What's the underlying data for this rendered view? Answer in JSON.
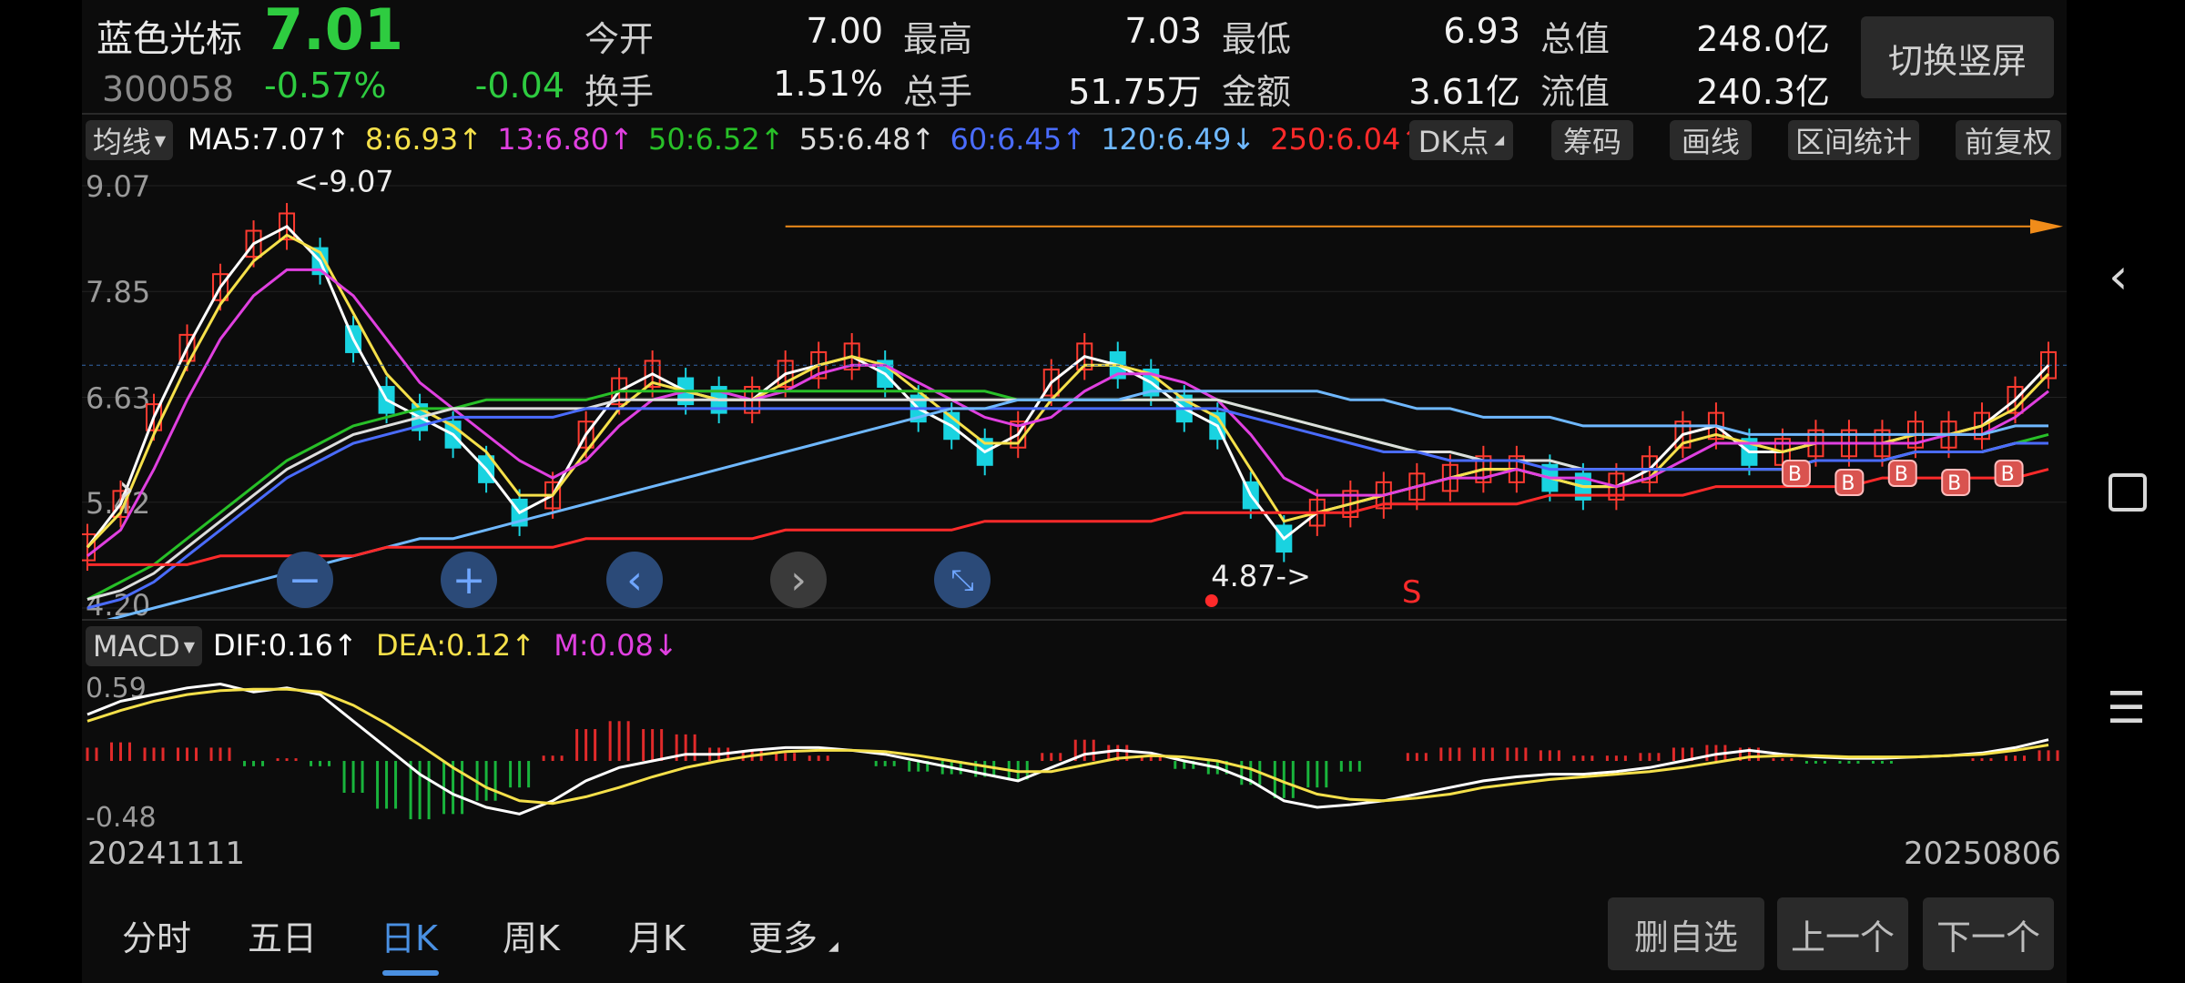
{
  "stock": {
    "name": "蓝色光标",
    "price": "7.01",
    "code": "300058",
    "change_pct": "-0.57%",
    "change": "-0.04"
  },
  "quote": {
    "open_label": "今开",
    "open": "7.00",
    "high_label": "最高",
    "high": "7.03",
    "low_label": "最低",
    "low": "6.93",
    "mktcap_label": "总值",
    "mktcap": "248.0亿",
    "turnover_label": "换手",
    "turnover": "1.51%",
    "volume_label": "总手",
    "volume": "51.75万",
    "amount_label": "金额",
    "amount": "3.61亿",
    "float_label": "流值",
    "float": "240.3亿"
  },
  "switch_button": "切换竖屏",
  "ma_bar": {
    "selector": "均线",
    "items": [
      {
        "text": "MA5:7.07↑",
        "color": "#ffffff"
      },
      {
        "text": "8:6.93↑",
        "color": "#f5e04a"
      },
      {
        "text": "13:6.80↑",
        "color": "#e040e0"
      },
      {
        "text": "50:6.52↑",
        "color": "#28c028"
      },
      {
        "text": "55:6.48↑",
        "color": "#dddddd"
      },
      {
        "text": "60:6.45↑",
        "color": "#4a6cff"
      },
      {
        "text": "120:6.49↓",
        "color": "#6fb8ff"
      },
      {
        "text": "250:6.04↑",
        "color": "#ff2a2a"
      }
    ],
    "buttons": [
      "DK点",
      "筹码",
      "画线",
      "区间统计",
      "前复权"
    ]
  },
  "chart_data": [
    {
      "type": "line",
      "title": "日K",
      "x_start": "20241111",
      "x_end": "20250806",
      "y_ticks": [
        "9.07",
        "7.85",
        "6.63",
        "5.42",
        "4.20"
      ],
      "ylim": [
        4.2,
        9.07
      ],
      "annotations": [
        "<-9.07",
        "4.87->",
        "S",
        "B"
      ],
      "series": [
        {
          "name": "MA5",
          "color": "#ffffff",
          "values": [
            4.9,
            5.4,
            6.4,
            7.2,
            7.9,
            8.4,
            8.6,
            8.2,
            7.3,
            6.6,
            6.4,
            6.2,
            5.8,
            5.3,
            5.5,
            6.2,
            6.7,
            6.9,
            6.7,
            6.6,
            6.6,
            6.9,
            7.0,
            7.1,
            6.9,
            6.5,
            6.3,
            6.0,
            6.2,
            6.8,
            7.1,
            7.0,
            6.8,
            6.5,
            6.3,
            5.5,
            5.0,
            5.3,
            5.4,
            5.5,
            5.6,
            5.7,
            5.8,
            5.8,
            5.7,
            5.6,
            5.6,
            5.8,
            6.2,
            6.3,
            6.0,
            6.0,
            6.1,
            6.1,
            6.1,
            6.2,
            6.2,
            6.3,
            6.6,
            7.0
          ]
        },
        {
          "name": "8",
          "color": "#f5e04a",
          "values": [
            4.9,
            5.3,
            6.2,
            7.0,
            7.7,
            8.2,
            8.5,
            8.3,
            7.6,
            6.9,
            6.5,
            6.3,
            6.0,
            5.5,
            5.5,
            6.0,
            6.5,
            6.8,
            6.7,
            6.6,
            6.6,
            6.8,
            7.0,
            7.1,
            7.0,
            6.7,
            6.4,
            6.1,
            6.1,
            6.6,
            7.0,
            7.0,
            6.9,
            6.6,
            6.4,
            5.8,
            5.2,
            5.3,
            5.4,
            5.5,
            5.6,
            5.7,
            5.8,
            5.8,
            5.7,
            5.6,
            5.6,
            5.7,
            6.1,
            6.2,
            6.1,
            6.0,
            6.1,
            6.1,
            6.1,
            6.2,
            6.2,
            6.3,
            6.5,
            6.9
          ]
        },
        {
          "name": "13",
          "color": "#e040e0",
          "values": [
            4.8,
            5.1,
            5.8,
            6.6,
            7.3,
            7.8,
            8.1,
            8.1,
            7.8,
            7.3,
            6.8,
            6.5,
            6.2,
            5.9,
            5.7,
            5.9,
            6.3,
            6.6,
            6.7,
            6.7,
            6.6,
            6.7,
            6.9,
            7.0,
            7.0,
            6.8,
            6.6,
            6.4,
            6.3,
            6.4,
            6.7,
            6.9,
            6.9,
            6.8,
            6.6,
            6.2,
            5.7,
            5.5,
            5.5,
            5.5,
            5.6,
            5.7,
            5.7,
            5.8,
            5.7,
            5.7,
            5.6,
            5.7,
            5.9,
            6.1,
            6.1,
            6.1,
            6.1,
            6.1,
            6.1,
            6.1,
            6.2,
            6.2,
            6.4,
            6.7
          ]
        },
        {
          "name": "50",
          "color": "#28c028",
          "values": [
            4.3,
            4.5,
            4.7,
            5.0,
            5.3,
            5.6,
            5.9,
            6.1,
            6.3,
            6.4,
            6.5,
            6.5,
            6.6,
            6.6,
            6.6,
            6.6,
            6.7,
            6.7,
            6.7,
            6.7,
            6.7,
            6.7,
            6.7,
            6.7,
            6.7,
            6.7,
            6.7,
            6.7,
            6.6,
            6.6,
            6.6,
            6.6,
            6.6,
            6.6,
            6.6,
            6.5,
            6.4,
            6.3,
            6.2,
            6.1,
            6.0,
            6.0,
            5.9,
            5.9,
            5.9,
            5.8,
            5.8,
            5.8,
            5.8,
            5.8,
            5.8,
            5.8,
            5.9,
            5.9,
            5.9,
            6.0,
            6.0,
            6.0,
            6.1,
            6.2
          ]
        },
        {
          "name": "55",
          "color": "#dddddd",
          "values": [
            4.3,
            4.4,
            4.6,
            4.9,
            5.2,
            5.5,
            5.8,
            6.0,
            6.2,
            6.3,
            6.4,
            6.5,
            6.5,
            6.5,
            6.5,
            6.5,
            6.6,
            6.6,
            6.6,
            6.6,
            6.6,
            6.6,
            6.6,
            6.6,
            6.6,
            6.6,
            6.6,
            6.6,
            6.6,
            6.6,
            6.6,
            6.6,
            6.6,
            6.6,
            6.6,
            6.5,
            6.4,
            6.3,
            6.2,
            6.1,
            6.0,
            6.0,
            5.9,
            5.9,
            5.9,
            5.8,
            5.8,
            5.8,
            5.8,
            5.8,
            5.8,
            5.8,
            5.9,
            5.9,
            5.9,
            6.0,
            6.0,
            6.0,
            6.1,
            6.1
          ]
        },
        {
          "name": "60",
          "color": "#4a6cff",
          "values": [
            4.2,
            4.3,
            4.5,
            4.8,
            5.1,
            5.4,
            5.7,
            5.9,
            6.1,
            6.2,
            6.3,
            6.4,
            6.4,
            6.4,
            6.4,
            6.5,
            6.5,
            6.5,
            6.5,
            6.5,
            6.5,
            6.5,
            6.5,
            6.5,
            6.5,
            6.5,
            6.5,
            6.5,
            6.5,
            6.5,
            6.5,
            6.5,
            6.5,
            6.5,
            6.5,
            6.4,
            6.3,
            6.2,
            6.1,
            6.0,
            6.0,
            5.9,
            5.9,
            5.9,
            5.8,
            5.8,
            5.8,
            5.8,
            5.8,
            5.8,
            5.8,
            5.8,
            5.9,
            5.9,
            5.9,
            6.0,
            6.0,
            6.0,
            6.1,
            6.1
          ]
        },
        {
          "name": "120",
          "color": "#6fb8ff",
          "values": [
            4.0,
            4.1,
            4.2,
            4.3,
            4.4,
            4.5,
            4.6,
            4.7,
            4.8,
            4.9,
            5.0,
            5.0,
            5.1,
            5.2,
            5.3,
            5.4,
            5.5,
            5.6,
            5.7,
            5.8,
            5.9,
            6.0,
            6.1,
            6.2,
            6.3,
            6.4,
            6.5,
            6.5,
            6.6,
            6.6,
            6.6,
            6.6,
            6.7,
            6.7,
            6.7,
            6.7,
            6.7,
            6.7,
            6.6,
            6.6,
            6.5,
            6.5,
            6.4,
            6.4,
            6.4,
            6.3,
            6.3,
            6.3,
            6.3,
            6.3,
            6.2,
            6.2,
            6.2,
            6.2,
            6.2,
            6.2,
            6.2,
            6.2,
            6.3,
            6.3
          ]
        },
        {
          "name": "250",
          "color": "#ff2a2a",
          "values": [
            4.7,
            4.7,
            4.7,
            4.7,
            4.8,
            4.8,
            4.8,
            4.8,
            4.8,
            4.9,
            4.9,
            4.9,
            4.9,
            4.9,
            4.9,
            5.0,
            5.0,
            5.0,
            5.0,
            5.0,
            5.0,
            5.1,
            5.1,
            5.1,
            5.1,
            5.1,
            5.1,
            5.2,
            5.2,
            5.2,
            5.2,
            5.2,
            5.2,
            5.3,
            5.3,
            5.3,
            5.3,
            5.3,
            5.3,
            5.4,
            5.4,
            5.4,
            5.4,
            5.4,
            5.5,
            5.5,
            5.5,
            5.5,
            5.5,
            5.6,
            5.6,
            5.6,
            5.6,
            5.6,
            5.7,
            5.7,
            5.7,
            5.7,
            5.7,
            5.8
          ]
        }
      ]
    },
    {
      "type": "bar",
      "title": "MACD",
      "y_ticks": [
        "0.59",
        "-0.48"
      ],
      "ylim": [
        -0.48,
        0.59
      ],
      "series": [
        {
          "name": "DIF",
          "color": "#ffffff",
          "values": [
            0.35,
            0.45,
            0.5,
            0.55,
            0.58,
            0.52,
            0.55,
            0.5,
            0.3,
            0.1,
            -0.1,
            -0.25,
            -0.35,
            -0.4,
            -0.3,
            -0.15,
            -0.05,
            0.0,
            0.05,
            0.05,
            0.08,
            0.1,
            0.1,
            0.08,
            0.05,
            0.0,
            -0.05,
            -0.1,
            -0.15,
            -0.05,
            0.05,
            0.08,
            0.06,
            0.0,
            -0.05,
            -0.15,
            -0.3,
            -0.35,
            -0.33,
            -0.3,
            -0.25,
            -0.2,
            -0.15,
            -0.12,
            -0.1,
            -0.1,
            -0.08,
            -0.05,
            0.0,
            0.05,
            0.08,
            0.05,
            0.03,
            0.02,
            0.02,
            0.03,
            0.04,
            0.06,
            0.1,
            0.16
          ]
        },
        {
          "name": "DEA",
          "color": "#f5e04a",
          "values": [
            0.3,
            0.38,
            0.45,
            0.5,
            0.53,
            0.54,
            0.54,
            0.52,
            0.42,
            0.28,
            0.12,
            -0.05,
            -0.2,
            -0.3,
            -0.32,
            -0.27,
            -0.2,
            -0.12,
            -0.05,
            0.0,
            0.04,
            0.07,
            0.08,
            0.08,
            0.07,
            0.04,
            0.0,
            -0.04,
            -0.08,
            -0.08,
            -0.03,
            0.02,
            0.04,
            0.03,
            0.0,
            -0.06,
            -0.16,
            -0.25,
            -0.29,
            -0.3,
            -0.28,
            -0.25,
            -0.2,
            -0.17,
            -0.14,
            -0.12,
            -0.1,
            -0.08,
            -0.05,
            -0.01,
            0.03,
            0.04,
            0.04,
            0.03,
            0.03,
            0.03,
            0.04,
            0.05,
            0.08,
            0.12
          ]
        },
        {
          "name": "M",
          "color": "#e040e0",
          "values": [
            0.1,
            0.14,
            0.1,
            0.1,
            0.1,
            -0.04,
            0.02,
            -0.04,
            -0.24,
            -0.36,
            -0.44,
            -0.4,
            -0.3,
            -0.2,
            0.04,
            0.24,
            0.3,
            0.24,
            0.2,
            0.1,
            0.08,
            0.06,
            0.04,
            0.0,
            -0.04,
            -0.08,
            -0.1,
            -0.12,
            -0.14,
            0.06,
            0.16,
            0.12,
            0.04,
            -0.06,
            -0.1,
            -0.18,
            -0.28,
            -0.2,
            -0.08,
            0.0,
            0.06,
            0.1,
            0.1,
            0.1,
            0.08,
            0.04,
            0.04,
            0.06,
            0.1,
            0.12,
            0.1,
            0.02,
            -0.02,
            -0.02,
            -0.02,
            0.0,
            0.0,
            0.02,
            0.04,
            0.08
          ]
        }
      ]
    }
  ],
  "macd_bar": {
    "selector": "MACD",
    "items": [
      {
        "text": "DIF:0.16↑",
        "color": "#ffffff"
      },
      {
        "text": "DEA:0.12↑",
        "color": "#f5e04a"
      },
      {
        "text": "M:0.08↓",
        "color": "#e040e0"
      }
    ]
  },
  "tabs": [
    {
      "label": "分时"
    },
    {
      "label": "五日"
    },
    {
      "label": "日K"
    },
    {
      "label": "周K"
    },
    {
      "label": "月K"
    },
    {
      "label": "更多"
    }
  ],
  "actions": [
    "删自选",
    "上一个",
    "下一个"
  ],
  "nav_icons": [
    "back-chevron-icon",
    "square-icon",
    "menu-icon"
  ],
  "zoom_icons": [
    "zoom-out-icon",
    "zoom-in-icon",
    "pan-left-icon",
    "pan-right-icon",
    "reset-icon"
  ]
}
